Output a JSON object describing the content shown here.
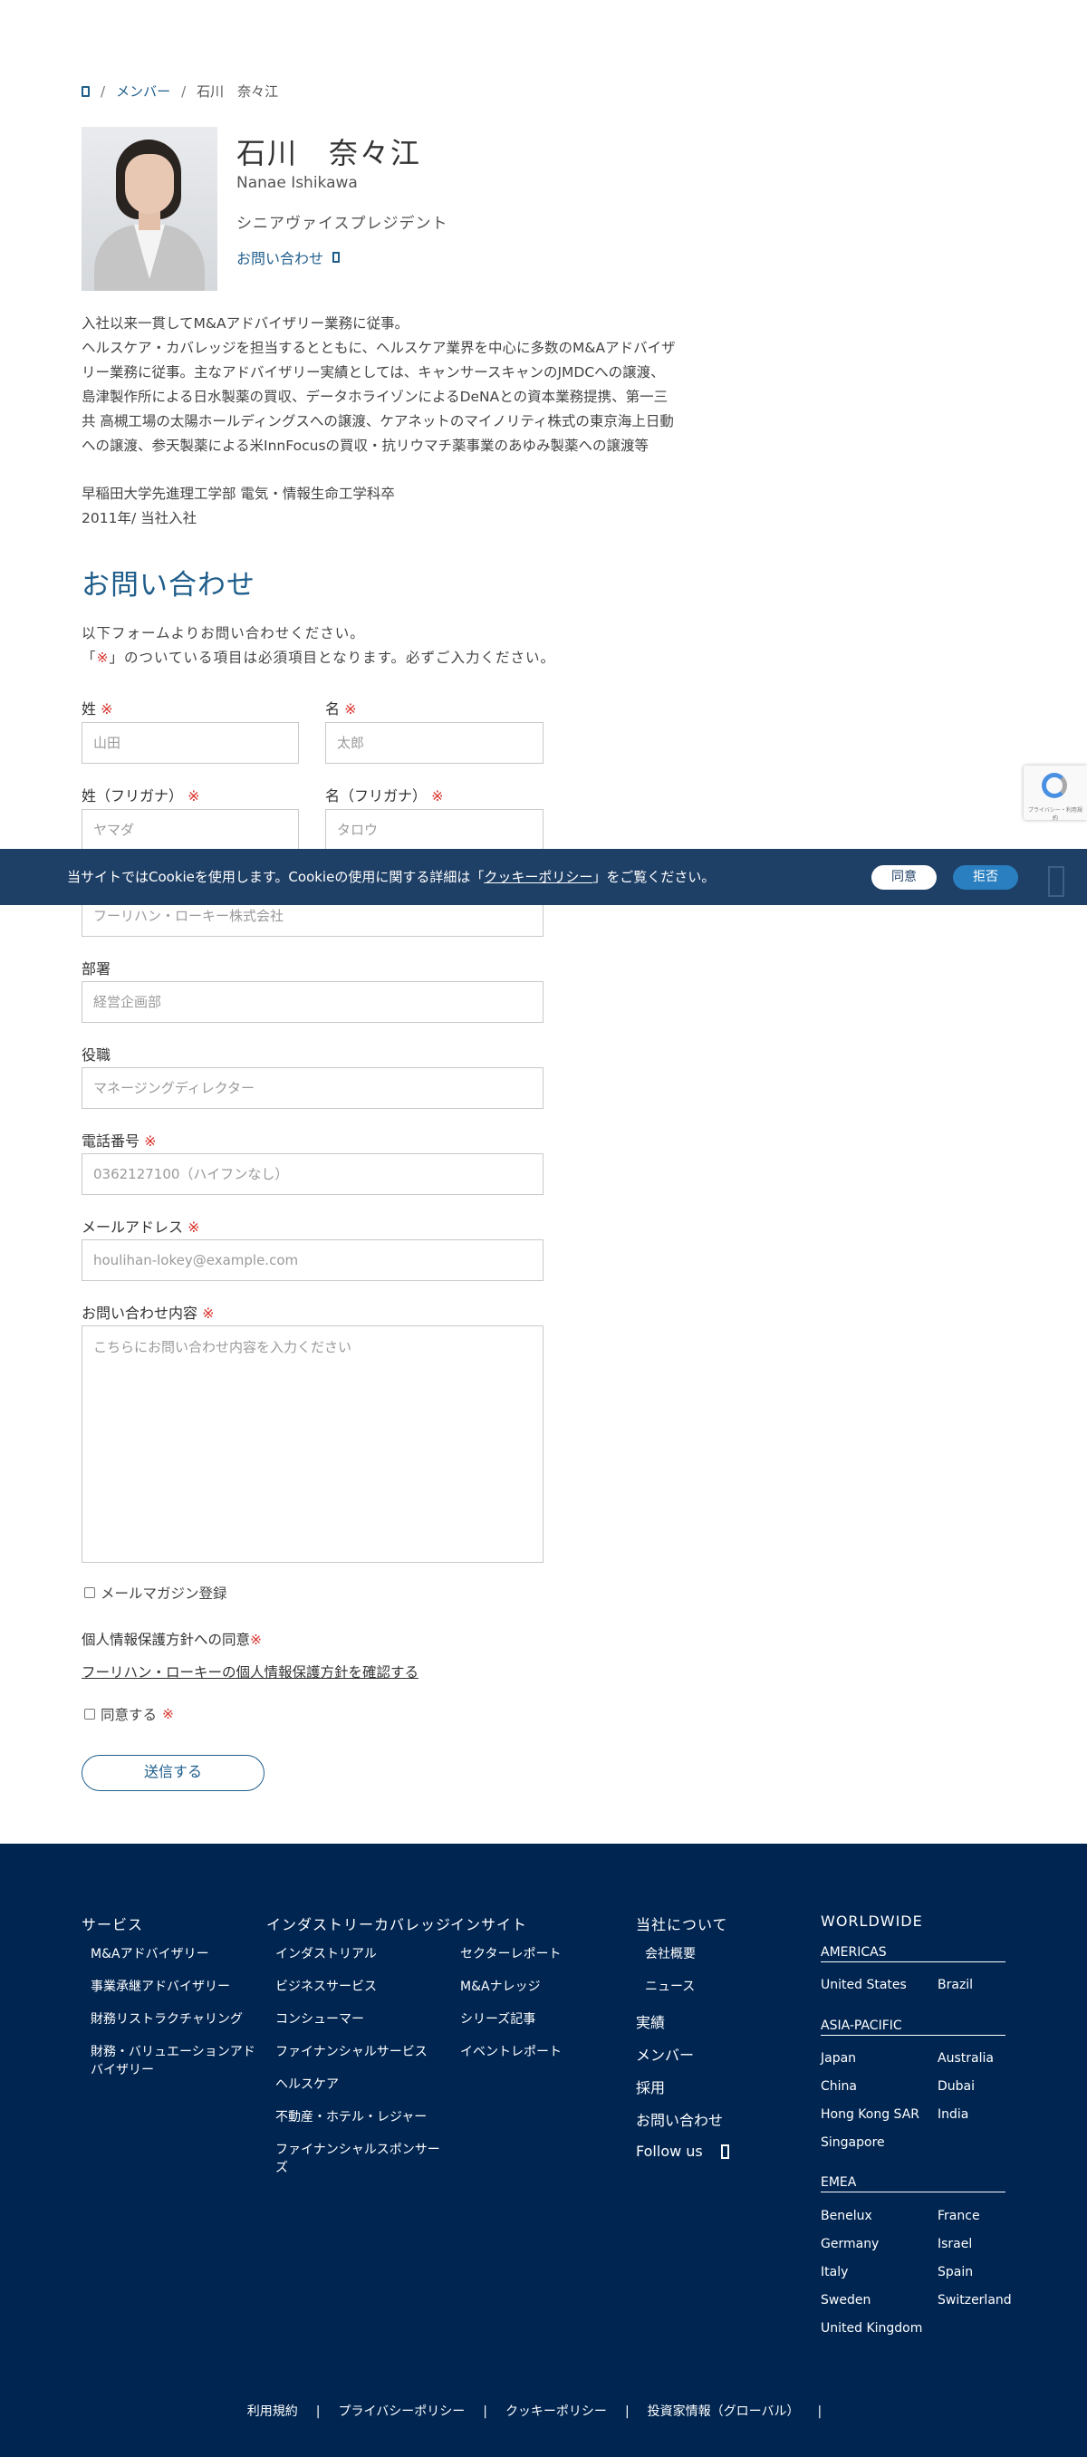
{
  "breadcrumb": {
    "members": "メンバー",
    "current": "石川　奈々江",
    "sep": "/"
  },
  "profile": {
    "name_jp": "石川　奈々江",
    "name_en": "Nanae Ishikawa",
    "role": "シニアヴァイスプレジデント",
    "contact_link": "お問い合わせ",
    "bio": [
      "入社以来一貫してM&Aアドバイザリー業務に従事。",
      "ヘルスケア・カバレッジを担当するとともに、ヘルスケア業界を中心に多数のM&Aアドバイザ",
      "リー業務に従事。主なアドバイザリー実績としては、キャンサースキャンのJMDCへの譲渡、",
      "島津製作所による日水製薬の買収、データホライゾンによるDeNAとの資本業務提携、第一三",
      "共 高槻工場の太陽ホールディングスへの譲渡、ケアネットのマイノリティ株式の東京海上日動",
      "への譲渡、参天製薬による米InnFocusの買収・抗リウマチ薬事業のあゆみ製薬への譲渡等"
    ],
    "education": [
      "早稲田大学先進理工学部 電気・情報生命工学科卒",
      "2011年/ 当社入社"
    ]
  },
  "contact": {
    "title": "お問い合わせ",
    "intro_1": "以下フォームよりお問い合わせください。",
    "intro_2a": "「",
    "intro_2_mark": "※",
    "intro_2b": "」のついている項目は必須項目となります。必ずご入力ください。",
    "required_mark": "※",
    "fields": {
      "last_name": {
        "label": "姓",
        "placeholder": "山田"
      },
      "first_name": {
        "label": "名",
        "placeholder": "太郎"
      },
      "last_kana": {
        "label": "姓（フリガナ）",
        "placeholder": "ヤマダ"
      },
      "first_kana": {
        "label": "名（フリガナ）",
        "placeholder": "タロウ"
      },
      "company": {
        "placeholder": "フーリハン・ローキー株式会社"
      },
      "department": {
        "label": "部署",
        "placeholder": "経営企画部"
      },
      "title": {
        "label": "役職",
        "placeholder": "マネージングディレクター"
      },
      "phone": {
        "label": "電話番号",
        "placeholder": "0362127100（ハイフンなし）"
      },
      "email": {
        "label": "メールアドレス",
        "placeholder": "houlihan-lokey@example.com"
      },
      "message": {
        "label": "お問い合わせ内容",
        "placeholder": "こちらにお問い合わせ内容を入力ください"
      }
    },
    "newsletter": "メールマガジン登録",
    "privacy_title": "個人情報保護方針への同意",
    "privacy_link": "フーリハン・ローキーの個人情報保護方針を確認する",
    "agree": "同意する",
    "submit": "送信する"
  },
  "recaptcha": {
    "text": "プライバシー・利用規約"
  },
  "cookie": {
    "text_before": "当サイトではCookieを使用します。Cookieの使用に関する詳細は「",
    "link": "クッキーポリシー",
    "text_after": "」をご覧ください。",
    "agree": "同意",
    "refuse": "拒否"
  },
  "footer": {
    "services": {
      "title": "サービス",
      "items": [
        "M&Aアドバイザリー",
        "事業承継アドバイザリー",
        "財務リストラクチャリング",
        "財務・バリュエーションアド",
        "バイザリー"
      ]
    },
    "industry": {
      "title": "インダストリーカバレッジ",
      "items": [
        "インダストリアル",
        "ビジネスサービス",
        "コンシューマー",
        "ファイナンシャルサービス",
        "ヘルスケア",
        "不動産・ホテル・レジャー",
        "ファイナンシャルスポンサー",
        "ズ"
      ]
    },
    "insight": {
      "title": "インサイト",
      "items": [
        "セクターレポート",
        "M&Aナレッジ",
        "シリーズ記事",
        "イベントレポート"
      ]
    },
    "company": {
      "title": "当社について",
      "items": [
        "会社概要",
        "ニュース"
      ],
      "links": [
        "実績",
        "メンバー",
        "採用",
        "お問い合わせ"
      ],
      "follow": "Follow us"
    },
    "worldwide": {
      "title": "WORLDWIDE",
      "americas": {
        "title": "AMERICAS",
        "items": [
          "United States",
          "Brazil"
        ]
      },
      "apac": {
        "title": "ASIA-PACIFIC",
        "items": [
          "Japan",
          "Australia",
          "China",
          "Dubai",
          "Hong Kong SAR",
          "India",
          "Singapore"
        ]
      },
      "emea": {
        "title": "EMEA",
        "items": [
          "Benelux",
          "France",
          "Germany",
          "Israel",
          "Italy",
          "Spain",
          "Sweden",
          "Switzerland",
          "United Kingdom"
        ]
      }
    },
    "bottom_links": [
      "利用規約",
      "プライバシーポリシー",
      "クッキーポリシー",
      "投資家情報（グローバル）"
    ],
    "sep": "|"
  }
}
